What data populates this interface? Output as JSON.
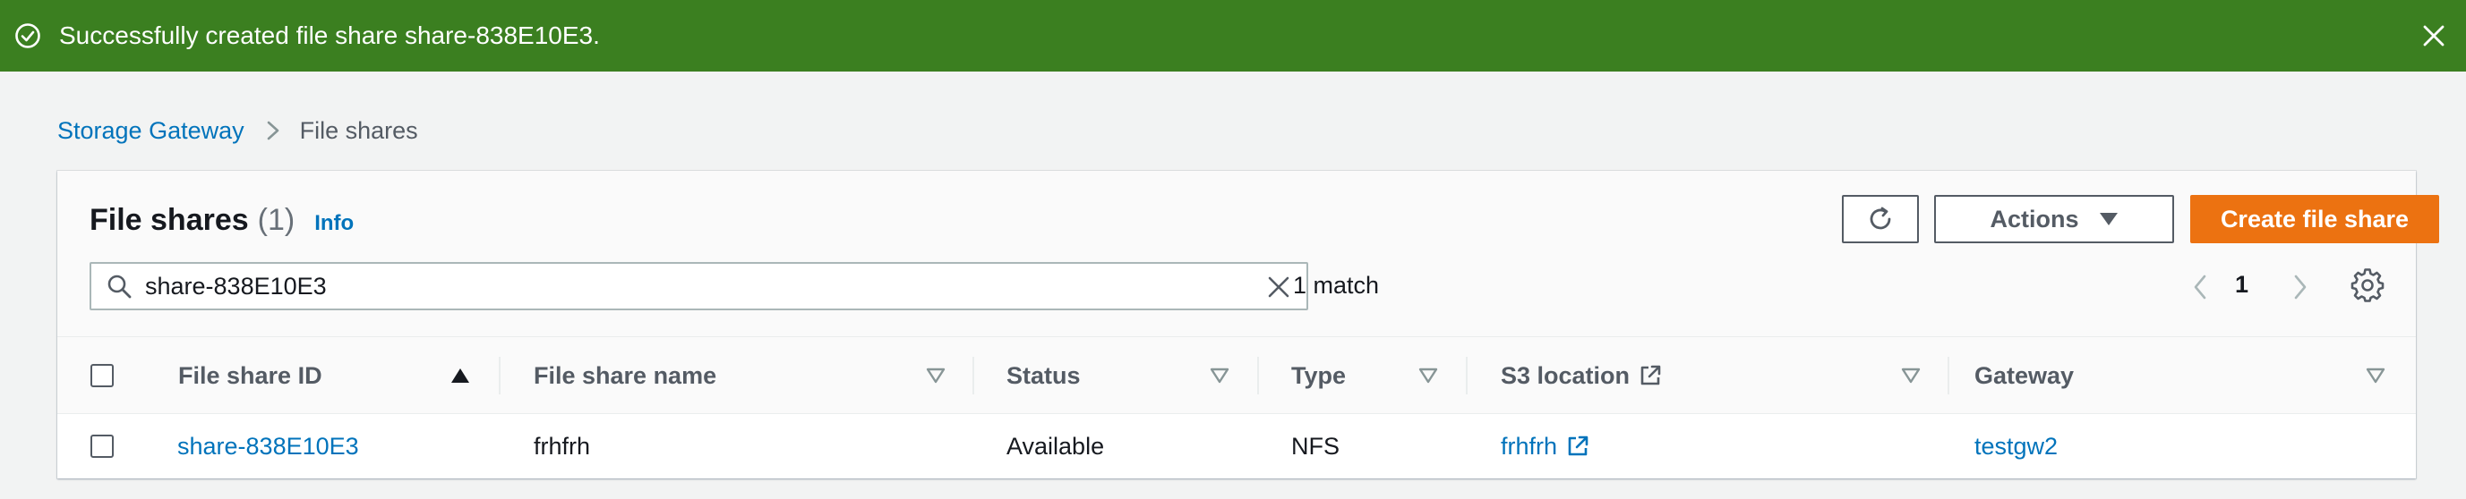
{
  "flash": {
    "message": "Successfully created file share share-838E10E3.",
    "status_icon": "check-circle-icon",
    "color": "#3b7f20"
  },
  "breadcrumb": {
    "items": [
      "Storage Gateway",
      "File shares"
    ]
  },
  "header": {
    "title": "File shares",
    "count": "(1)",
    "info_label": "Info",
    "actions_label": "Actions",
    "create_label": "Create file share",
    "primary_color": "#ec7211"
  },
  "filter": {
    "value": "share-838E10E3",
    "match_text": "1 match"
  },
  "pagination": {
    "current_page": "1"
  },
  "table": {
    "columns": [
      "File share ID",
      "File share name",
      "Status",
      "Type",
      "S3 location",
      "Gateway"
    ],
    "sorted_column": "File share ID",
    "rows": [
      {
        "file_share_id": "share-838E10E3",
        "file_share_name": "frhfrh",
        "status": "Available",
        "type": "NFS",
        "s3_location": "frhfrh",
        "gateway": "testgw2"
      }
    ]
  },
  "link_color": "#0073bb"
}
